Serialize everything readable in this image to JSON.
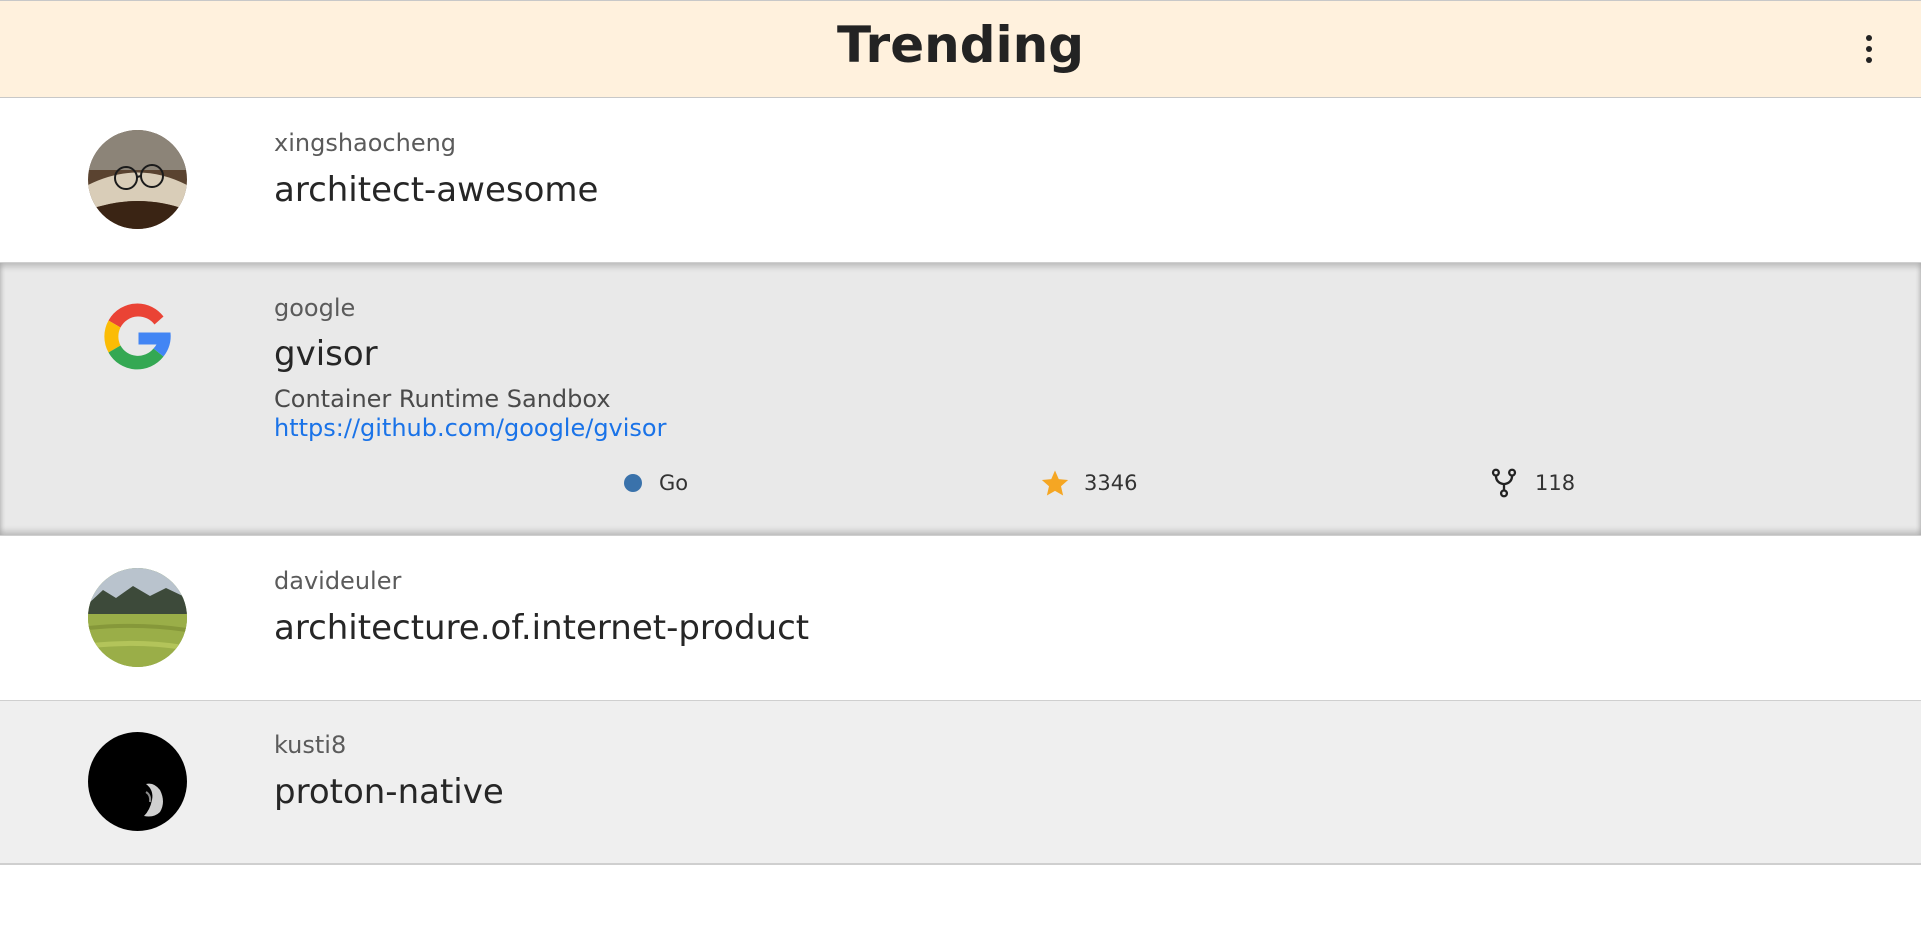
{
  "header": {
    "title": "Trending"
  },
  "repos": [
    {
      "owner": "xingshaocheng",
      "name": "architect-awesome"
    },
    {
      "owner": "google",
      "name": "gvisor",
      "description": "Container Runtime Sandbox",
      "url": "https://github.com/google/gvisor",
      "language": "Go",
      "language_color": "#3a72ab",
      "stars": "3346",
      "forks": "118"
    },
    {
      "owner": "davideuler",
      "name": "architecture.of.internet-product"
    },
    {
      "owner": "kusti8",
      "name": "proton-native"
    }
  ],
  "icons": {
    "menu": "more-vert-icon",
    "star": "star-icon",
    "fork": "fork-icon",
    "star_color": "#f5a623"
  },
  "colors": {
    "header_bg": "#fff1dd",
    "selected_row_bg": "#e9e9e9",
    "link": "#1a73e8"
  }
}
